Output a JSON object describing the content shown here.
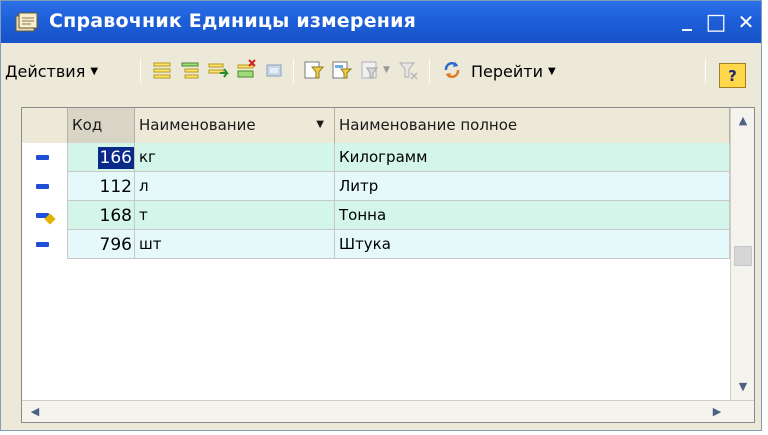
{
  "window": {
    "title": "Справочник Единицы измерения",
    "minimize_glyph": "_",
    "maximize_glyph": "□",
    "close_glyph": "✕"
  },
  "toolbar": {
    "actions_label": "Действия",
    "goto_label": "Перейти",
    "help_label": "?"
  },
  "table": {
    "columns": [
      "Код",
      "Наименование",
      "Наименование полное"
    ],
    "sorted_column": "Наименование",
    "rows": [
      {
        "code": "166",
        "name": "кг",
        "full_name": "Килограмм",
        "marker": "dash",
        "selected": true
      },
      {
        "code": "112",
        "name": "л",
        "full_name": "Литр",
        "marker": "dash",
        "selected": false
      },
      {
        "code": "168",
        "name": "т",
        "full_name": "Тонна",
        "marker": "dash-pen",
        "selected": false
      },
      {
        "code": "796",
        "name": "шт",
        "full_name": "Штука",
        "marker": "dash",
        "selected": false
      }
    ]
  },
  "colors": {
    "titlebar": "#1d5fd9",
    "row_even": "#d3f5ea",
    "row_odd": "#e5f9fb",
    "selection": "#0a2a8a",
    "marker": "#1f4fd8"
  }
}
